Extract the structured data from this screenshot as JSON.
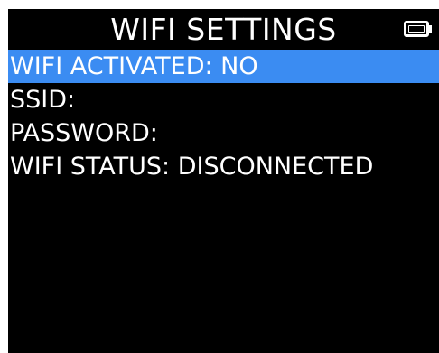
{
  "header": {
    "title": "WIFI SETTINGS",
    "battery_icon": "battery-icon"
  },
  "menu": {
    "items": [
      {
        "label": "WIFI ACTIVATED: NO",
        "selected": true
      },
      {
        "label": "SSID:",
        "selected": false
      },
      {
        "label": "PASSWORD:",
        "selected": false
      },
      {
        "label": "WIFI STATUS: DISCONNECTED",
        "selected": false
      }
    ]
  },
  "colors": {
    "background": "#000000",
    "text": "#ffffff",
    "selection": "#3b8cf2"
  }
}
